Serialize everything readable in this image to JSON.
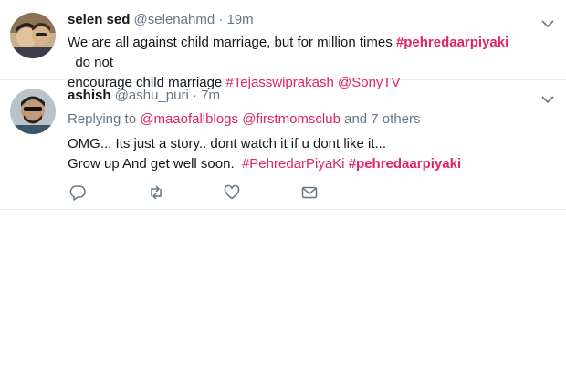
{
  "tweets": [
    {
      "name": "selen sed",
      "handle": "@selenahmd",
      "dot": "·",
      "time": "19m",
      "line1_text": "We are all against child marriage, but for million times ",
      "line1_tag": "#pehredaarpiyaki",
      "line1_rest": "  do not",
      "line2_text": "encourage child marriage ",
      "line2_tag": "#Tejasswiprakash",
      "line2_space": " ",
      "line2_mention": "@SonyTV"
    },
    {
      "name": "ashish",
      "handle": "@ashu_puri",
      "dot": "·",
      "time": "7m",
      "replying_prefix": "Replying to ",
      "replying_mention_1": "@maaofallblogs",
      "replying_space": " ",
      "replying_mention_2": "@firstmomsclub",
      "replying_suffix": " and 7 others",
      "line1_text": "OMG... Its just a story.. dont watch it if u dont like it...",
      "line2_text": "Grow up And get well soon.  ",
      "line2_tag1": "#PehredarPiyaKi",
      "line2_space": " ",
      "line2_tag2": "#pehredaarpiyaki",
      "actions": [
        "reply-icon",
        "retweet-icon",
        "like-icon",
        "message-icon"
      ]
    }
  ],
  "colors": {
    "hashtag": "#e0245e",
    "secondary_text": "#657786",
    "icon": "#657786",
    "divider": "#e6ecf0"
  }
}
